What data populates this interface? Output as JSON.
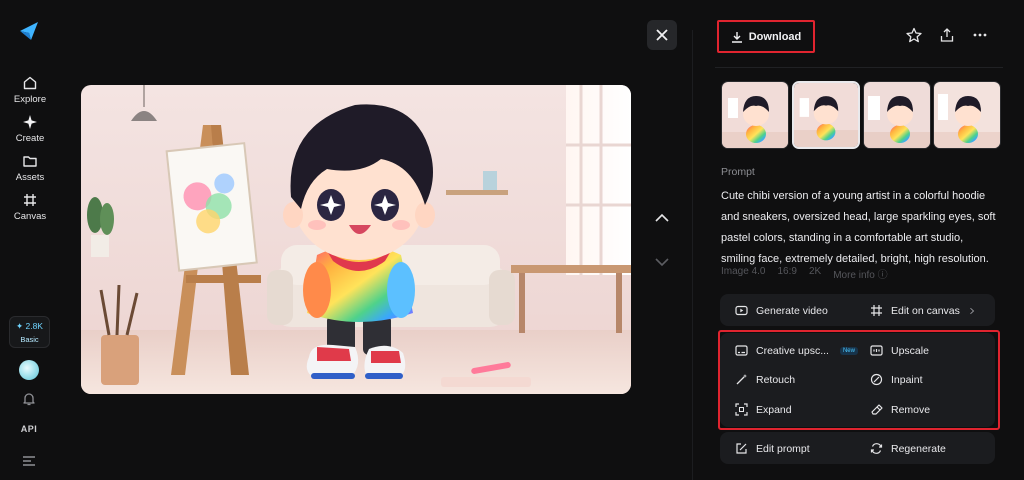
{
  "sidebar": {
    "nav": [
      {
        "label": "Explore",
        "icon": "home-icon"
      },
      {
        "label": "Create",
        "icon": "sparkle-icon"
      },
      {
        "label": "Assets",
        "icon": "folder-icon"
      },
      {
        "label": "Canvas",
        "icon": "canvas-icon"
      }
    ],
    "credits": {
      "amount": "✦ 2.8K",
      "plan": "Basic"
    },
    "api_label": "API"
  },
  "toolbar": {
    "download_label": "Download"
  },
  "prompt": {
    "label": "Prompt",
    "text": "Cute chibi version of a young artist in a colorful hoodie and sneakers, oversized head, large sparkling eyes, soft pastel colors, standing in a comfortable art studio, smiling face, extremely detailed, bright, high resolution.",
    "meta": [
      "Image 4.0",
      "16:9",
      "2K",
      "More info ⓘ"
    ]
  },
  "actions_primary": {
    "generate_video": "Generate video",
    "edit_on_canvas": "Edit on canvas"
  },
  "actions_tools": {
    "creative_upscale": "Creative upsc...",
    "new_badge": "New",
    "upscale": "Upscale",
    "retouch": "Retouch",
    "inpaint": "Inpaint",
    "expand": "Expand",
    "remove": "Remove"
  },
  "actions_secondary": {
    "edit_prompt": "Edit prompt",
    "regenerate": "Regenerate"
  },
  "colors": {
    "accent_red": "#e0242f",
    "brand_blue": "#3fb4ff",
    "panel_bg": "#1b1c1f",
    "page_bg": "#0f0f10"
  }
}
